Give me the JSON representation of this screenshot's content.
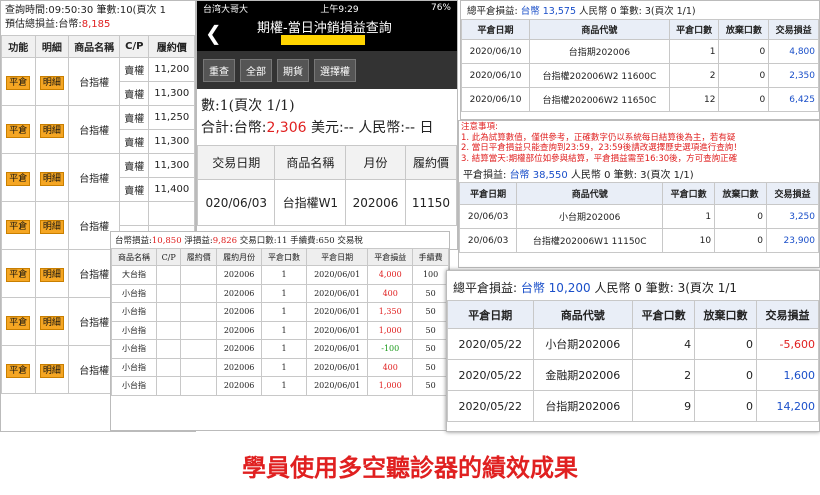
{
  "panelA": {
    "line1": "查詢時間:09:50:30 筆數:10(頁次 1",
    "line2_label": "預估總損益:台幣:",
    "line2_value": "8,185",
    "headers": [
      "功能",
      "明細",
      "商品名稱",
      "C/P",
      "履約價"
    ],
    "rows": [
      {
        "btn1": "平倉",
        "btn2": "明細",
        "name": "台指權",
        "cp": [
          "賣權",
          "賣權"
        ],
        "price": [
          "11,200",
          "11,300"
        ]
      },
      {
        "btn1": "平倉",
        "btn2": "明細",
        "name": "台指權",
        "cp": [
          "賣權",
          "賣權"
        ],
        "price": [
          "11,250",
          "11,300"
        ]
      },
      {
        "btn1": "平倉",
        "btn2": "明細",
        "name": "台指權",
        "cp": [
          "賣權",
          "賣權"
        ],
        "price": [
          "11,300",
          "11,400"
        ]
      },
      {
        "btn1": "平倉",
        "btn2": "明細",
        "name": "台指權",
        "cp": [
          "",
          ""
        ],
        "price": [
          "",
          ""
        ]
      },
      {
        "btn1": "平倉",
        "btn2": "明細",
        "name": "台指權",
        "cp": [
          "",
          ""
        ],
        "price": [
          "",
          ""
        ]
      },
      {
        "btn1": "平倉",
        "btn2": "明細",
        "name": "台指權",
        "cp": [
          "",
          ""
        ],
        "price": [
          "",
          ""
        ]
      },
      {
        "btn1": "平倉",
        "btn2": "明細",
        "name": "台指權",
        "cp": [
          "",
          ""
        ],
        "price": [
          "",
          ""
        ]
      }
    ]
  },
  "panelB": {
    "carrier": "台湾大哥大",
    "time": "上午9:29",
    "battery": "76%",
    "title": "期權-當日沖銷損益查詢",
    "buttons": [
      "重查",
      "全部",
      "期貨",
      "選擇權"
    ],
    "count": "數:1(頁次 1/1)",
    "total_prefix": "合計:台幣:",
    "total_value": "2,306",
    "total_suffix": " 美元:-- 人民幣:-- 日",
    "headers": [
      "交易日期",
      "商品名稱",
      "月份",
      "履約價"
    ],
    "row": [
      "020/06/03",
      "台指權W1",
      "202006",
      "11150"
    ]
  },
  "panelC": {
    "sum_prefix": "台幣損益:",
    "sum_value": "10,850",
    "net_label": " 淨損益:",
    "net_value": "9,826",
    "rest": " 交易口數:11 手續費:650 交易稅",
    "headers": [
      "商品名稱",
      "C/P",
      "履約價",
      "履約月份",
      "平倉口數",
      "平倉日期",
      "平倉損益",
      "手續費"
    ],
    "rows": [
      [
        "大台指",
        "",
        "",
        "202006",
        "1",
        "2020/06/01",
        "4,000",
        "100",
        "red"
      ],
      [
        "小台指",
        "",
        "",
        "202006",
        "1",
        "2020/06/01",
        "400",
        "50",
        "red"
      ],
      [
        "小台指",
        "",
        "",
        "202006",
        "1",
        "2020/06/01",
        "1,350",
        "50",
        "red"
      ],
      [
        "小台指",
        "",
        "",
        "202006",
        "1",
        "2020/06/01",
        "1,000",
        "50",
        "red"
      ],
      [
        "小台指",
        "",
        "",
        "202006",
        "1",
        "2020/06/01",
        "-100",
        "50",
        "green"
      ],
      [
        "小台指",
        "",
        "",
        "202006",
        "1",
        "2020/06/01",
        "400",
        "50",
        "red"
      ],
      [
        "小台指",
        "",
        "",
        "202006",
        "1",
        "2020/06/01",
        "1,000",
        "50",
        "red"
      ]
    ]
  },
  "panelD": {
    "sum_prefix": "總平倉損益: ",
    "sum_value": "台幣 13,575",
    "sum_rest": " 人民幣 0 筆數: 3(頁次 1/1)",
    "headers": [
      "平倉日期",
      "商品代號",
      "平倉口數",
      "放棄口數",
      "交易損益"
    ],
    "rows": [
      [
        "2020/06/10",
        "台指期202006",
        "1",
        "0",
        "4,800"
      ],
      [
        "2020/06/10",
        "台指權202006W2 11600C",
        "2",
        "0",
        "2,350"
      ],
      [
        "2020/06/10",
        "台指權202006W2 11650C",
        "12",
        "0",
        "6,425"
      ]
    ]
  },
  "panelE": {
    "notes": [
      "注意事項:",
      "1. 此為試算數值，僅供參考，正確數字仍以系統每日結算後為主，若有疑",
      "2. 當日平倉損益只能查詢到23:59，23:59後請改選擇歷史選項進行查詢！",
      "3. 結算當天:期權部位如參與結算，平倉損益需至16:30後，方可查詢正確"
    ],
    "sum_prefix": "平倉損益: ",
    "sum_value": "台幣 38,550",
    "sum_rest": " 人民幣 0 筆數: 3(頁次 1/1)",
    "headers": [
      "平倉日期",
      "商品代號",
      "平倉口數",
      "放棄口數",
      "交易損益"
    ],
    "rows": [
      [
        "20/06/03",
        "小台期202006",
        "1",
        "0",
        "3,250"
      ],
      [
        "20/06/03",
        "台指權202006W1 11150C",
        "10",
        "0",
        "23,900"
      ]
    ]
  },
  "panelF": {
    "sum_prefix": "總平倉損益: ",
    "sum_value": "台幣 10,200",
    "sum_rest": " 人民幣 0 筆數: 3(頁次 1/1",
    "headers": [
      "平倉日期",
      "商品代號",
      "平倉口數",
      "放棄口數",
      "交易損益"
    ],
    "rows": [
      [
        "2020/05/22",
        "小台期202006",
        "4",
        "0",
        "-5,600",
        "red"
      ],
      [
        "2020/05/22",
        "金融期202006",
        "2",
        "0",
        "1,600",
        "blue"
      ],
      [
        "2020/05/22",
        "台指期202006",
        "9",
        "0",
        "14,200",
        "blue"
      ]
    ]
  },
  "caption": "學員使用多空聽診器的績效成果"
}
